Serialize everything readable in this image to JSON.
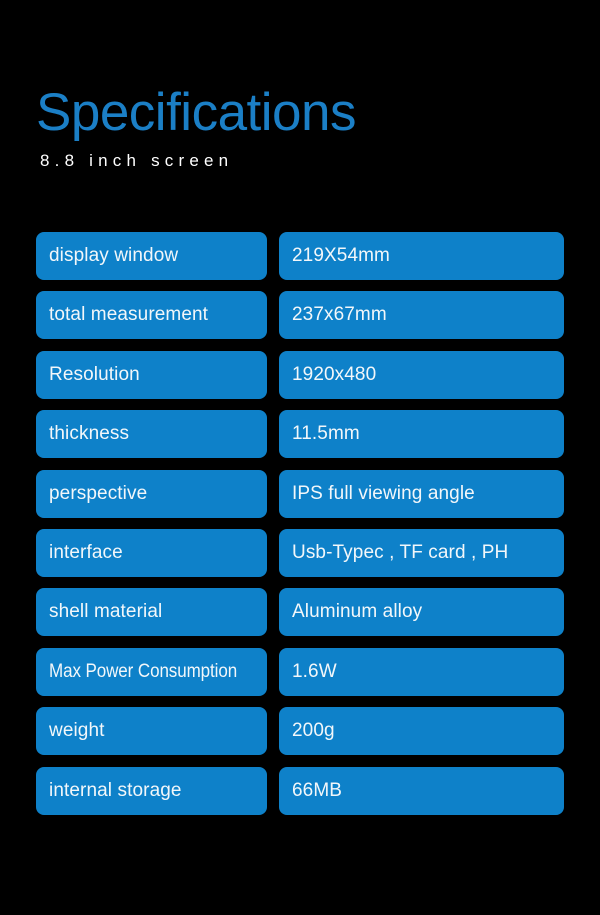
{
  "header": {
    "title": "Specifications",
    "subtitle": "8.8 inch screen"
  },
  "colors": {
    "background": "#000000",
    "title_blue": "#1b7fc6",
    "pill_blue": "#0e81c9",
    "pill_text": "#f2f7fa",
    "subtitle_text": "#ffffff"
  },
  "spec_table": {
    "rows": [
      {
        "label": "display window",
        "value": "219X54mm"
      },
      {
        "label": "total measurement",
        "value": "237x67mm"
      },
      {
        "label": "Resolution",
        "value": "1920x480"
      },
      {
        "label": "thickness",
        "value": "11.5mm"
      },
      {
        "label": "perspective",
        "value": "IPS full viewing angle"
      },
      {
        "label": "interface",
        "value": "Usb-Typec , TF card , PH"
      },
      {
        "label": "shell material",
        "value": "Aluminum alloy"
      },
      {
        "label": "Max Power Consumption",
        "value": "1.6W"
      },
      {
        "label": "weight",
        "value": "200g"
      },
      {
        "label": "internal storage",
        "value": "66MB"
      }
    ]
  }
}
